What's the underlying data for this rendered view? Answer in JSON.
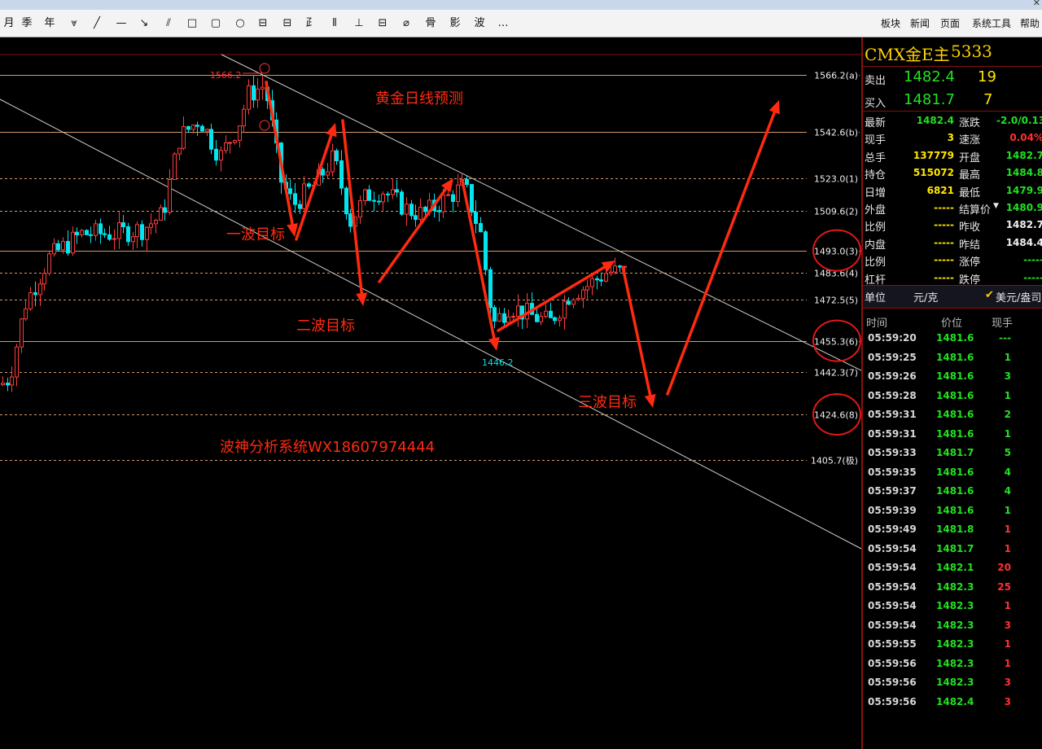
{
  "toolbar": {
    "left_items": [
      "月",
      "季",
      "年",
      "⩔",
      "╱",
      "—",
      "↘",
      "⫽",
      "□",
      "▢",
      "○",
      "⊟",
      "⊟",
      "⺪",
      "⫴",
      "⊥",
      "⊟",
      "⌀",
      "⻣",
      "影",
      "波",
      "…"
    ],
    "right_items": [
      "板块",
      "新闻",
      "页面",
      "系统工具",
      "帮助"
    ]
  },
  "chart": {
    "title_annotation": "黄金日线预测",
    "wave1": "一波目标",
    "wave2": "二波目标",
    "wave3": "三波目标",
    "watermark": "波神分析系统WX18607974444",
    "high_label": "1566.2",
    "low_label": "1446.2",
    "levels": [
      {
        "price": 1566.2,
        "label": "1566.2(a)"
      },
      {
        "price": 1542.6,
        "label": "1542.6(b)"
      },
      {
        "price": 1523.0,
        "label": "1523.0(1)"
      },
      {
        "price": 1509.6,
        "label": "1509.6(2)"
      },
      {
        "price": 1493.0,
        "label": "1493.0(3)"
      },
      {
        "price": 1483.6,
        "label": "1483.6(4)"
      },
      {
        "price": 1472.5,
        "label": "1472.5(5)"
      },
      {
        "price": 1455.3,
        "label": "1455.3(6)"
      },
      {
        "price": 1442.3,
        "label": "1442.3(7)"
      },
      {
        "price": 1424.6,
        "label": "1424.6(8)"
      },
      {
        "price": 1405.7,
        "label": "1405.7(极)"
      }
    ],
    "circled_levels": [
      "1493.0(3)",
      "1455.3(6)",
      "1424.6(8)"
    ],
    "colors": {
      "up": "#ff3b3b",
      "down": "#00e5ee",
      "level": "#d49a6a",
      "arrow": "#ff2a10",
      "channel": "#cfcfcf"
    }
  },
  "panel": {
    "title": "CMX金E主",
    "code": "5333",
    "sell_label": "卖出",
    "sell_price": "1482.4",
    "sell_qty": "19",
    "buy_label": "买入",
    "buy_price": "1481.7",
    "buy_qty": "7",
    "stats_left": [
      {
        "label": "最新",
        "value": "1482.4",
        "color": "green"
      },
      {
        "label": "现手",
        "value": "3",
        "color": "yellow"
      },
      {
        "label": "总手",
        "value": "137779",
        "color": "yellow"
      },
      {
        "label": "持仓",
        "value": "515072",
        "color": "yellow"
      },
      {
        "label": "日增",
        "value": "6821",
        "color": "yellow"
      },
      {
        "label": "外盘",
        "value": "-----",
        "color": "yellow"
      },
      {
        "label": "比例",
        "value": "-----",
        "color": "yellow"
      },
      {
        "label": "内盘",
        "value": "-----",
        "color": "yellow"
      },
      {
        "label": "比例",
        "value": "-----",
        "color": "yellow"
      },
      {
        "label": "杠杆",
        "value": "-----",
        "color": "yellow"
      }
    ],
    "stats_right": [
      {
        "label": "涨跌",
        "value": "-2.0/0.13%",
        "color": "green"
      },
      {
        "label": "速涨",
        "value": "0.04%",
        "color": "red"
      },
      {
        "label": "开盘",
        "value": "1482.7",
        "color": "green"
      },
      {
        "label": "最高",
        "value": "1484.8",
        "color": "green"
      },
      {
        "label": "最低",
        "value": "1479.9",
        "color": "green"
      },
      {
        "label": "结算价",
        "value": "1480.9",
        "color": "green"
      },
      {
        "label": "昨收",
        "value": "1482.7",
        "color": "white"
      },
      {
        "label": "昨结",
        "value": "1484.4",
        "color": "white"
      },
      {
        "label": "涨停",
        "value": "-----",
        "color": "green"
      },
      {
        "label": "跌停",
        "value": "-----",
        "color": "green"
      }
    ],
    "unit_label": "单位",
    "unit_value": "元/克",
    "unit_option": "美元/盎司",
    "tick_headers": [
      "时间",
      "价位",
      "现手"
    ],
    "ticks": [
      {
        "time": "05:59:20",
        "price": "1481.6",
        "vol": "---",
        "c": "green"
      },
      {
        "time": "05:59:25",
        "price": "1481.6",
        "vol": "1",
        "c": "green"
      },
      {
        "time": "05:59:26",
        "price": "1481.6",
        "vol": "3",
        "c": "green"
      },
      {
        "time": "05:59:28",
        "price": "1481.6",
        "vol": "1",
        "c": "green"
      },
      {
        "time": "05:59:31",
        "price": "1481.6",
        "vol": "2",
        "c": "green"
      },
      {
        "time": "05:59:31",
        "price": "1481.6",
        "vol": "1",
        "c": "green"
      },
      {
        "time": "05:59:33",
        "price": "1481.7",
        "vol": "5",
        "c": "green"
      },
      {
        "time": "05:59:35",
        "price": "1481.6",
        "vol": "4",
        "c": "green"
      },
      {
        "time": "05:59:37",
        "price": "1481.6",
        "vol": "4",
        "c": "green"
      },
      {
        "time": "05:59:39",
        "price": "1481.6",
        "vol": "1",
        "c": "green"
      },
      {
        "time": "05:59:49",
        "price": "1481.8",
        "vol": "1",
        "c": "red"
      },
      {
        "time": "05:59:54",
        "price": "1481.7",
        "vol": "1",
        "c": "red"
      },
      {
        "time": "05:59:54",
        "price": "1482.1",
        "vol": "20",
        "c": "red"
      },
      {
        "time": "05:59:54",
        "price": "1482.3",
        "vol": "25",
        "c": "red"
      },
      {
        "time": "05:59:54",
        "price": "1482.3",
        "vol": "1",
        "c": "red"
      },
      {
        "time": "05:59:54",
        "price": "1482.3",
        "vol": "3",
        "c": "red"
      },
      {
        "time": "05:59:55",
        "price": "1482.3",
        "vol": "1",
        "c": "red"
      },
      {
        "time": "05:59:56",
        "price": "1482.3",
        "vol": "1",
        "c": "red"
      },
      {
        "time": "05:59:56",
        "price": "1482.3",
        "vol": "3",
        "c": "red"
      },
      {
        "time": "05:59:56",
        "price": "1482.4",
        "vol": "3",
        "c": "red"
      }
    ]
  }
}
